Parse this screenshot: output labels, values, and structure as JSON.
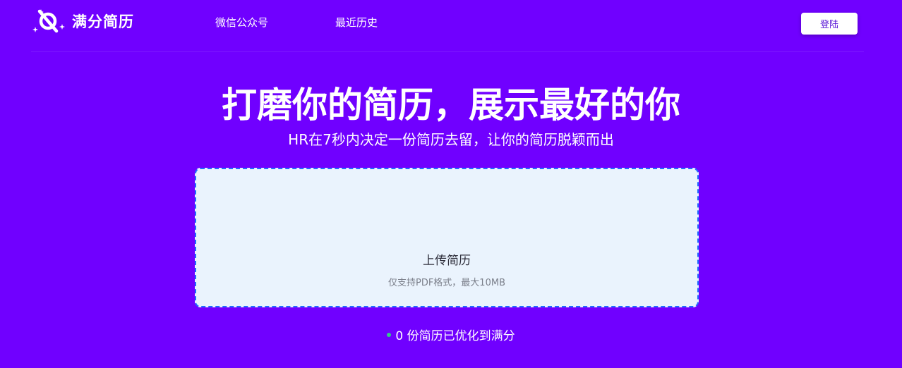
{
  "header": {
    "logo_text": "满分简历",
    "nav": {
      "wechat": "微信公众号",
      "history": "最近历史"
    },
    "login_label": "登陆"
  },
  "hero": {
    "title": "打磨你的简历，展示最好的你",
    "subtitle": "HR在7秒内决定一份简历去留，让你的简历脱颖而出"
  },
  "upload": {
    "title": "上传简历",
    "hint": "仅支持PDF格式，最大10MB"
  },
  "stats": {
    "text": "0 份简历已优化到满分"
  },
  "colors": {
    "background": "#7000ff",
    "upload_bg": "#eaf3fd",
    "upload_border": "#1e6bff",
    "status_dot": "#34c98a",
    "login_text": "#5a17d6"
  },
  "icons": {
    "logo": "sparkle-resume-logo-icon",
    "status": "status-dot-icon"
  }
}
